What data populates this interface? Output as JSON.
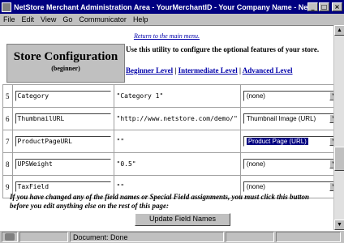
{
  "window": {
    "title": "NetStore Merchant Administration Area - YourMerchantID - Your Company Name - Netscape",
    "min": "_",
    "max": "□",
    "close": "×"
  },
  "menu": [
    "File",
    "Edit",
    "View",
    "Go",
    "Communicator",
    "Help"
  ],
  "page": {
    "return_link": "Return to the main menu.",
    "heading": "Store Configuration",
    "subheading": "(beginner)",
    "intro": "Use this utility to configure the optional features of your store.",
    "levels": {
      "beginner": "Beginner Level",
      "intermediate": "Intermediate Level",
      "advanced": "Advanced Level",
      "sep": "|"
    }
  },
  "rows": [
    {
      "num": "5",
      "name": "Category",
      "default": "\"Category 1\"",
      "type": "(none)",
      "highlighted": false
    },
    {
      "num": "6",
      "name": "ThumbnailURL",
      "default": "\"http://www.netstore.com/demo/\"",
      "type": "Thumbnail Image (URL)",
      "highlighted": false
    },
    {
      "num": "7",
      "name": "ProductPageURL",
      "default": "\"\"",
      "type": "Product Page (URL)",
      "highlighted": true
    },
    {
      "num": "8",
      "name": "UPSWeight",
      "default": "\"0.5\"",
      "type": "(none)",
      "highlighted": false
    },
    {
      "num": "9",
      "name": "TaxField",
      "default": "\"\"",
      "type": "(none)",
      "highlighted": false
    }
  ],
  "notice": "If you have changed any of the field names or Special Field assignments, you must click this button before you edit anything else on the rest of this page:",
  "update_button": "Update Field Names",
  "status": {
    "text": "Document: Done"
  }
}
